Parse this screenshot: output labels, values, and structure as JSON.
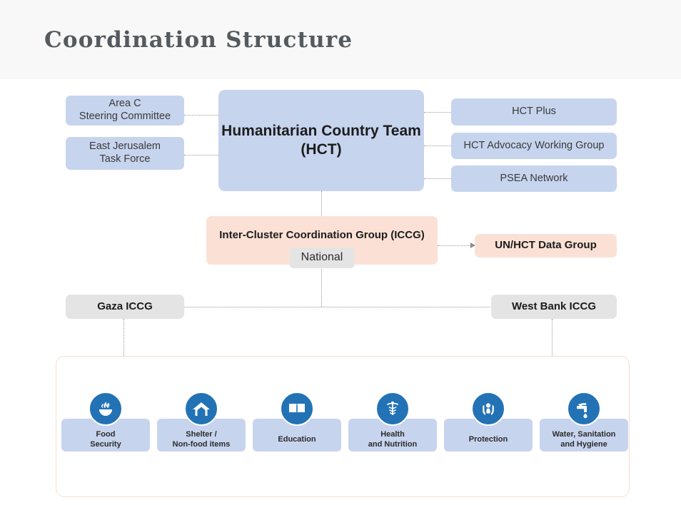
{
  "header": {
    "title": "Coordination Structure",
    "band_color": "#f8f8f8",
    "title_color": "#555a5e"
  },
  "colors": {
    "blue_box": "#c7d4ee",
    "peach_box": "#fbe1d5",
    "gray_box": "#e4e4e4",
    "icon_blue": "#2372b5",
    "panel_border": "#f7ddd1",
    "connector": "#9a9a9a"
  },
  "diagram": {
    "center": {
      "hct_label": "Humanitarian Country Team\n(HCT)"
    },
    "left_nodes": [
      {
        "label": "Area C\nSteering Committee"
      },
      {
        "label": "East Jerusalem\nTask Force"
      }
    ],
    "right_nodes": [
      {
        "label": "HCT Plus"
      },
      {
        "label": "HCT Advocacy Working Group"
      },
      {
        "label": "PSEA Network"
      }
    ],
    "iccg": {
      "title": "Inter-Cluster Coordination Group (ICCG)",
      "chip": "National"
    },
    "data_group": {
      "label": "UN/HCT Data Group"
    },
    "regional_nodes": [
      {
        "label": "Gaza ICCG"
      },
      {
        "label": "West Bank ICCG"
      }
    ],
    "clusters": [
      {
        "label": "Food\nSecurity",
        "icon": "food-bowl-icon"
      },
      {
        "label": "Shelter /\nNon-food items",
        "icon": "house-icon"
      },
      {
        "label": "Education",
        "icon": "open-book-icon"
      },
      {
        "label": "Health\nand Nutrition",
        "icon": "caduceus-icon"
      },
      {
        "label": "Protection",
        "icon": "protecting-hands-icon"
      },
      {
        "label": "Water, Sanitation\nand Hygiene",
        "icon": "faucet-drop-icon"
      }
    ]
  }
}
